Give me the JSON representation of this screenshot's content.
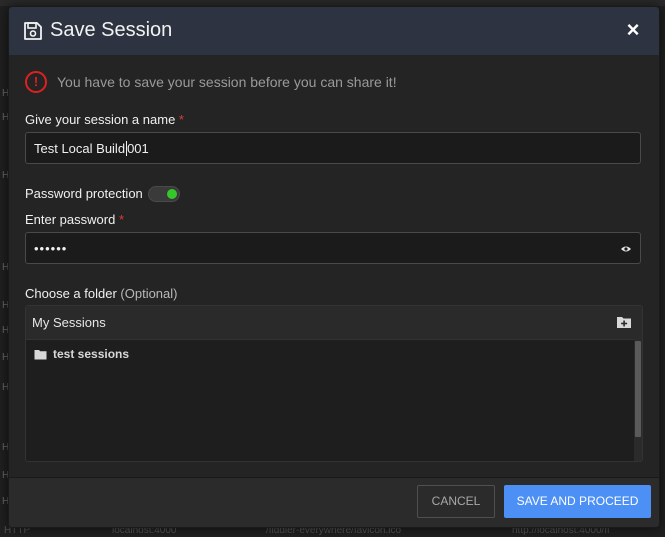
{
  "background": {
    "row_markers": [
      "H",
      "H",
      "H",
      "H",
      "H",
      "H",
      "H",
      "H",
      "H",
      "H",
      "H"
    ],
    "bottom_row": [
      "HTTP",
      "localhost:4000",
      "/fiddler-everywhere/favicon.ico",
      "http://localhost:4000/fi"
    ]
  },
  "modal": {
    "icon": "floppy-disk-icon",
    "title": "Save Session",
    "close_icon": "close-icon",
    "close_label": "×"
  },
  "warning": {
    "icon": "exclamation-circle-icon",
    "icon_glyph": "!",
    "text": "You have to save your session before you can share it!",
    "color": "#e02020"
  },
  "session_name": {
    "label": "Give your session a name",
    "required_mark": "*",
    "value_before_caret": "Test Local Build",
    "value_after_caret": "001"
  },
  "password_protection": {
    "label": "Password protection",
    "enabled": true,
    "toggle_color": "#34c82a"
  },
  "password": {
    "label": "Enter password",
    "required_mark": "*",
    "masked_value": "••••••",
    "reveal_icon": "eye-icon"
  },
  "folder": {
    "label": "Choose a folder",
    "optional_text": "(Optional)",
    "root_label": "My Sessions",
    "add_folder_icon": "add-folder-icon",
    "items": [
      {
        "label": "test sessions",
        "icon": "folder-icon"
      }
    ]
  },
  "footer": {
    "cancel_label": "CANCEL",
    "proceed_label": "SAVE AND PROCEED",
    "accent_color": "#4c8ff5"
  }
}
